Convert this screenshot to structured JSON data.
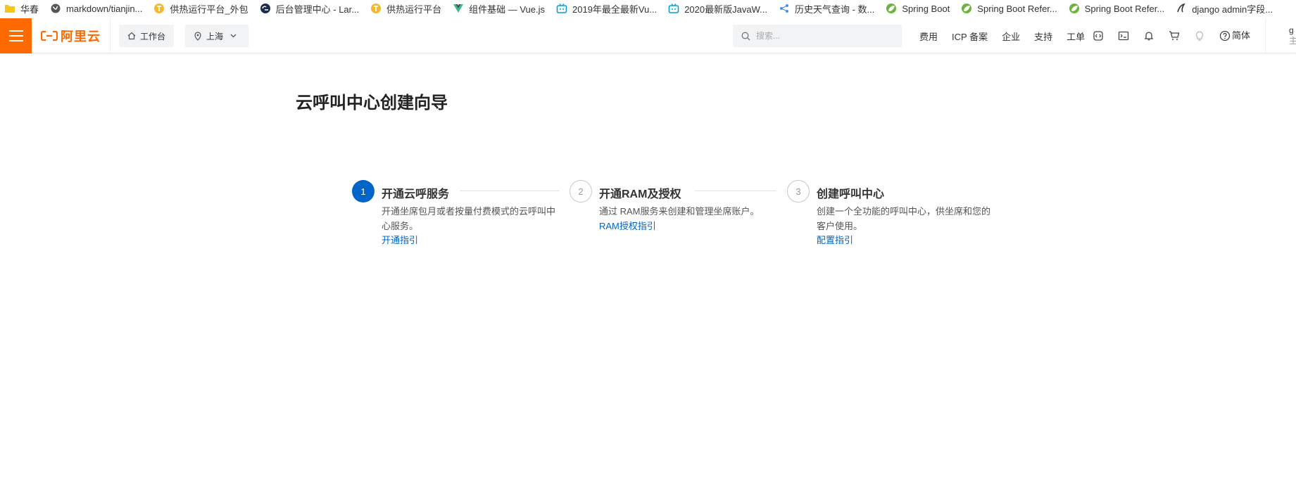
{
  "bookmarks": [
    {
      "label": "华春",
      "icon": "folder-icon"
    },
    {
      "label": "markdown/tianjin...",
      "icon": "globe-icon"
    },
    {
      "label": "供热运行平台_外包",
      "icon": "t-badge-icon"
    },
    {
      "label": "后台管理中心 - Lar...",
      "icon": "cz-logo-icon"
    },
    {
      "label": "供热运行平台",
      "icon": "t-badge-icon"
    },
    {
      "label": "组件基础 — Vue.js",
      "icon": "vue-icon"
    },
    {
      "label": "2019年最全最新Vu...",
      "icon": "bilibili-icon"
    },
    {
      "label": "2020最新版JavaW...",
      "icon": "bilibili-icon"
    },
    {
      "label": "历史天气查询 - 数...",
      "icon": "share-icon"
    },
    {
      "label": "Spring Boot",
      "icon": "spring-icon"
    },
    {
      "label": "Spring Boot Refer...",
      "icon": "spring-icon"
    },
    {
      "label": "Spring Boot Refer...",
      "icon": "spring-icon"
    },
    {
      "label": "django admin字段...",
      "icon": "django-icon"
    }
  ],
  "header": {
    "logo_text": "阿里云",
    "workbench_label": "工作台",
    "region_label": "上海",
    "search_placeholder": "搜索...",
    "links": [
      "费用",
      "ICP 备案",
      "企业",
      "支持",
      "工单"
    ],
    "icons": [
      "code-icon",
      "terminal-icon",
      "bell-icon",
      "cart-icon",
      "lightbulb-icon",
      "help-icon"
    ],
    "lang_label": "简体",
    "account_line1": "g",
    "account_line2": "主"
  },
  "page": {
    "title": "云呼叫中心创建向导"
  },
  "steps": [
    {
      "number": "1",
      "title": "开通云呼服务",
      "desc": "开通坐席包月或者按量付费模式的云呼叫中心服务。",
      "link": "开通指引",
      "active": true
    },
    {
      "number": "2",
      "title": "开通RAM及授权",
      "desc": "通过 RAM服务来创建和管理坐席账户。",
      "link": "RAM授权指引",
      "active": false
    },
    {
      "number": "3",
      "title": "创建呼叫中心",
      "desc": "创建一个全功能的呼叫中心，供坐席和您的客户使用。",
      "link": "配置指引",
      "active": false
    }
  ],
  "colors": {
    "brand_orange": "#ff6a00",
    "primary_blue": "#0064c8"
  }
}
